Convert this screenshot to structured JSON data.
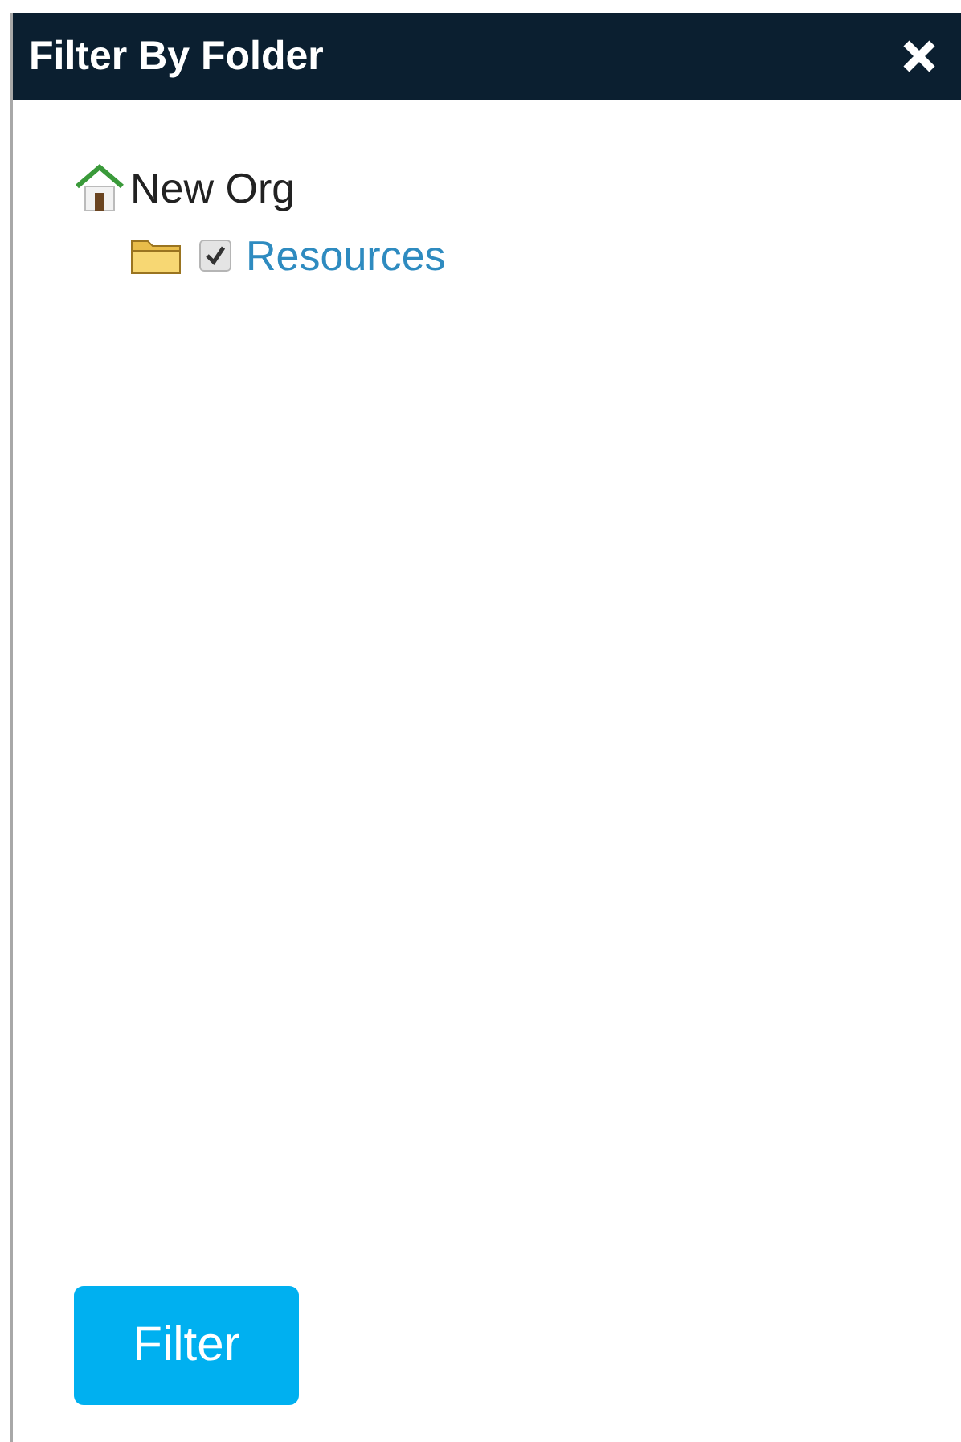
{
  "dialog": {
    "title": "Filter By Folder"
  },
  "tree": [
    {
      "kind": "org",
      "label": "New Org",
      "children": [
        {
          "kind": "folder",
          "label": "Resources",
          "checked": true
        }
      ]
    }
  ],
  "button": "Filter"
}
